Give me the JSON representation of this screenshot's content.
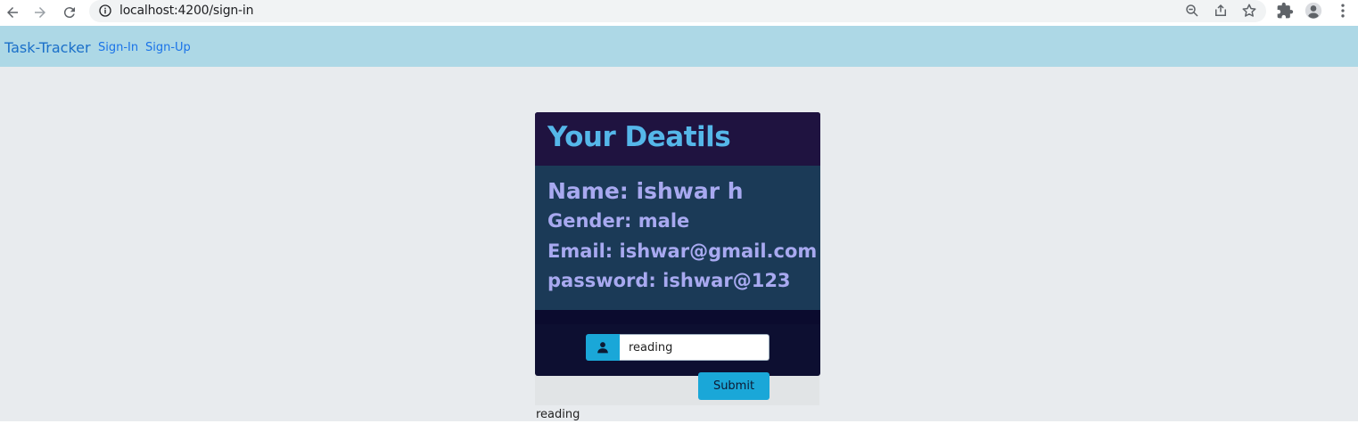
{
  "browser": {
    "url": "localhost:4200/sign-in",
    "icons": {
      "back": "arrow-left-icon",
      "forward": "arrow-right-icon",
      "reload": "reload-icon",
      "site_info": "info-icon",
      "zoom": "zoom-out-icon",
      "share": "share-icon",
      "bookmark": "star-icon",
      "extensions": "puzzle-icon",
      "profile": "avatar-icon",
      "menu": "kebab-menu-icon"
    }
  },
  "navbar": {
    "brand": "Task-Tracker",
    "links": [
      "Sign-In",
      "Sign-Up"
    ],
    "background": "#add8e6"
  },
  "card": {
    "title": "Your Deatils",
    "details": {
      "name": "Name: ishwar h",
      "gender": "Gender: male",
      "email": "Email: ishwar@gmail.com",
      "password": "password: ishwar@123"
    }
  },
  "form": {
    "input_value": "reading",
    "input_icon": "person-icon",
    "submit_label": "Submit",
    "output": "reading"
  },
  "colors": {
    "accent": "#1aa7d8",
    "title": "#55b7e9",
    "detail_text": "#a8a9f0",
    "card_header": "#1f1340",
    "card_body": "#1b3a57"
  }
}
